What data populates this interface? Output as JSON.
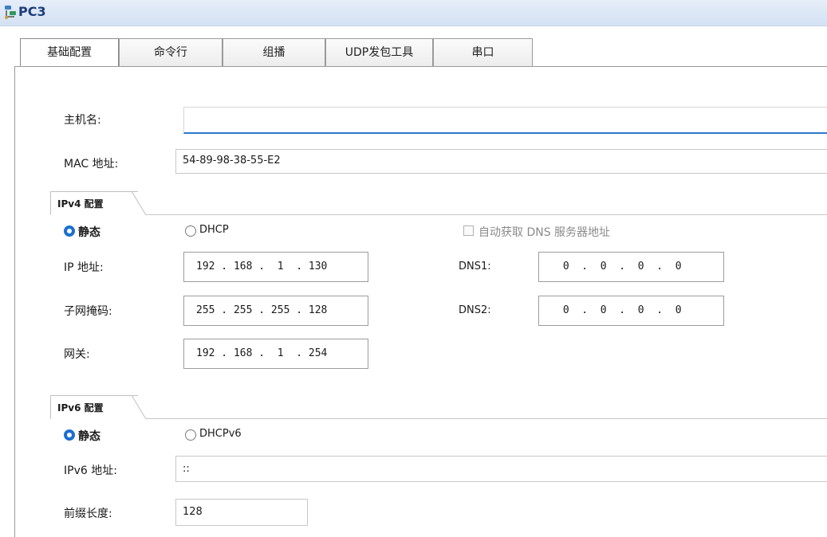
{
  "window": {
    "title": "PC3"
  },
  "tabs": [
    {
      "label": "基础配置",
      "active": true
    },
    {
      "label": "命令行"
    },
    {
      "label": "组播"
    },
    {
      "label": "UDP发包工具"
    },
    {
      "label": "串口"
    }
  ],
  "basic": {
    "hostname_label": "主机名:",
    "hostname_value": "",
    "mac_label": "MAC 地址:",
    "mac_value": "54-89-98-38-55-E2"
  },
  "ipv4": {
    "section_title": "IPv4 配置",
    "static_label": "静态",
    "dhcp_label": "DHCP",
    "mode": "静态",
    "auto_dns_label": "自动获取 DNS 服务器地址",
    "auto_dns_checked": false,
    "ip_label": "IP 地址:",
    "ip_value": "192 . 168 .  1  . 130",
    "mask_label": "子网掩码:",
    "mask_value": "255 . 255 . 255 . 128",
    "gateway_label": "网关:",
    "gateway_value": "192 . 168 .  1  . 254",
    "dns1_label": "DNS1:",
    "dns1_value": " 0  .  0  .  0  .  0",
    "dns2_label": "DNS2:",
    "dns2_value": " 0  .  0  .  0  .  0"
  },
  "ipv6": {
    "section_title": "IPv6 配置",
    "static_label": "静态",
    "dhcp_label": "DHCPv6",
    "mode": "静态",
    "address_label": "IPv6 地址:",
    "address_value": "::",
    "prefix_label": "前缀长度:",
    "prefix_value": "128"
  },
  "colors": {
    "accent": "#1c6fd0",
    "title_text": "#1b3d7a",
    "focus_underline": "#2f78c8"
  },
  "icons": {
    "app": "pc-network-icon"
  }
}
